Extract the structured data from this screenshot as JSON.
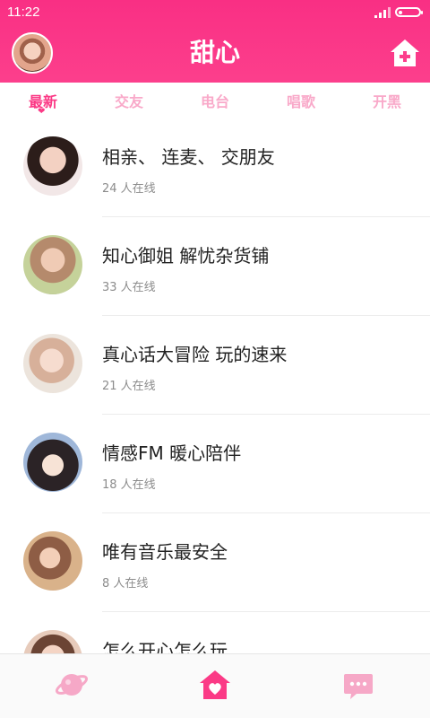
{
  "status": {
    "time": "11:22"
  },
  "header": {
    "logo_text": "甜心"
  },
  "tabs": [
    {
      "label": "最新",
      "active": true
    },
    {
      "label": "交友",
      "active": false
    },
    {
      "label": "电台",
      "active": false
    },
    {
      "label": "唱歌",
      "active": false
    },
    {
      "label": "开黑",
      "active": false
    }
  ],
  "rooms": [
    {
      "title": "相亲、 连麦、 交朋友",
      "online": "24 人在线"
    },
    {
      "title": "知心御姐  解忧杂货铺",
      "online": "33 人在线"
    },
    {
      "title": "真心话大冒险  玩的速来",
      "online": "21 人在线"
    },
    {
      "title": "情感FM  暖心陪伴",
      "online": "18 人在线"
    },
    {
      "title": "唯有音乐最安全",
      "online": "8 人在线"
    },
    {
      "title": "怎么开心怎么玩",
      "online": ""
    }
  ],
  "colors": {
    "brand": "#fb3a86",
    "tab_inactive": "#f9a9c9",
    "nav_icon": "#f6a8c7"
  },
  "bottom_nav": [
    {
      "icon": "planet-icon"
    },
    {
      "icon": "home-heart-icon"
    },
    {
      "icon": "chat-bubble-icon"
    }
  ]
}
